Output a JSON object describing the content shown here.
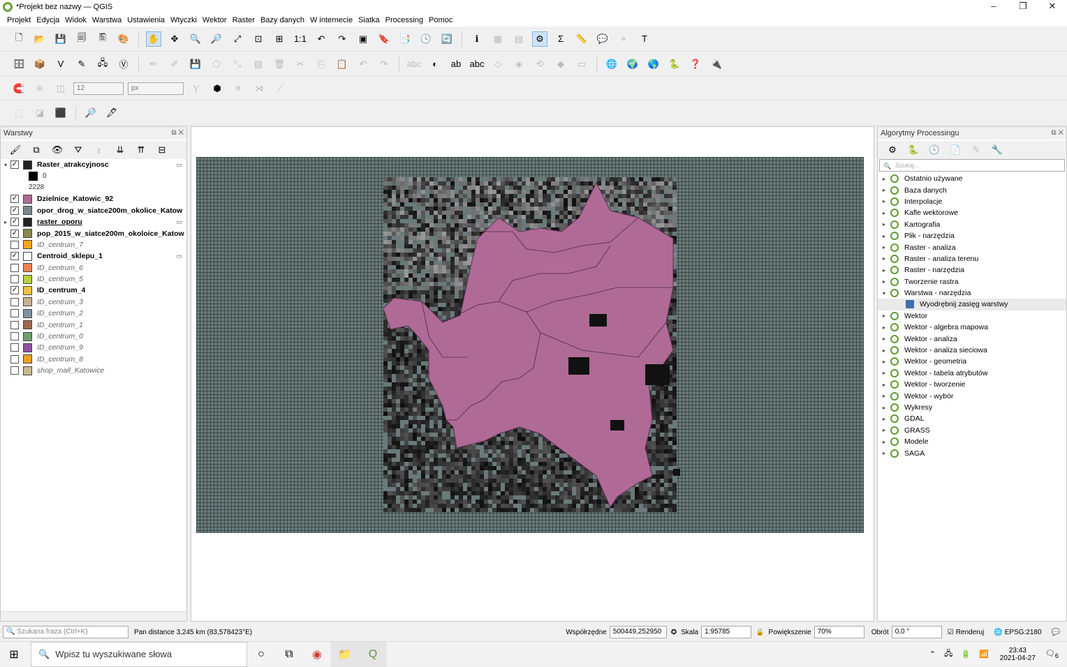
{
  "window": {
    "title": "*Projekt bez nazwy — QGIS",
    "minimize": "–",
    "restore": "❐",
    "close": "✕"
  },
  "menu": [
    "Projekt",
    "Edycja",
    "Widok",
    "Warstwa",
    "Ustawienia",
    "Wtyczki",
    "Wektor",
    "Raster",
    "Bazy danych",
    "W internecie",
    "Siatka",
    "Processing",
    "Pomoc"
  ],
  "snapping": {
    "tolerance": "12",
    "unit": "px"
  },
  "layers_panel": {
    "title": "Warstwy",
    "items": [
      {
        "name": "Raster_atrakcyjnosc",
        "checked": true,
        "style": "bold",
        "color": "#222222",
        "expand": "▾",
        "filter": true
      },
      {
        "legend": "0",
        "color": "#000000"
      },
      {
        "legend": "2228",
        "color": ""
      },
      {
        "name": "Dzielnice_Katowic_92",
        "checked": true,
        "style": "bold",
        "color": "#b06a96"
      },
      {
        "name": "opor_drog_w_siatce200m_okolice_Katow",
        "checked": true,
        "style": "bold",
        "color": "#7a8890"
      },
      {
        "name": "raster_oporu",
        "checked": true,
        "style": "und",
        "color": "#222222",
        "expand": "▸",
        "filter": true
      },
      {
        "name": "pop_2015_w_siatce200m_okoloice_Katow",
        "checked": true,
        "style": "bold",
        "color": "#8a8a4a"
      },
      {
        "name": "ID_centrum_7",
        "checked": false,
        "style": "ital",
        "color": "#f5a623"
      },
      {
        "name": "Centroid_sklepu_1",
        "checked": true,
        "style": "bold",
        "color": "#ffffff",
        "filter": true
      },
      {
        "name": "ID_centrum_6",
        "checked": false,
        "style": "ital",
        "color": "#f08050"
      },
      {
        "name": "ID_centrum_5",
        "checked": false,
        "style": "ital",
        "color": "#b8d040"
      },
      {
        "name": "ID_centrum_4",
        "checked": true,
        "style": "bold",
        "color": "#f0c040"
      },
      {
        "name": "ID_centrum_3",
        "checked": false,
        "style": "ital",
        "color": "#c8b090"
      },
      {
        "name": "ID_centrum_2",
        "checked": false,
        "style": "ital",
        "color": "#8090a0"
      },
      {
        "name": "ID_centrum_1",
        "checked": false,
        "style": "ital",
        "color": "#a06850"
      },
      {
        "name": "ID_centrum_0",
        "checked": false,
        "style": "ital",
        "color": "#70a070"
      },
      {
        "name": "ID_centrum_9",
        "checked": false,
        "style": "ital",
        "color": "#9050a0"
      },
      {
        "name": "ID_centrum_8",
        "checked": false,
        "style": "ital",
        "color": "#f0a020"
      },
      {
        "name": "shop_mall_Katowice",
        "checked": false,
        "style": "ital",
        "color": "#c8b890"
      }
    ]
  },
  "processing_panel": {
    "title": "Algorytmy Processingu",
    "search_placeholder": "Szukaj...",
    "items": [
      {
        "label": "Ostatnio używane",
        "icon": "clock-icon"
      },
      {
        "label": "Baza danych"
      },
      {
        "label": "Interpolacje"
      },
      {
        "label": "Kafle wektorowe"
      },
      {
        "label": "Kartografia"
      },
      {
        "label": "Plik - narzędzia"
      },
      {
        "label": "Raster - analiza"
      },
      {
        "label": "Raster - analiza terenu"
      },
      {
        "label": "Raster - narzędzia"
      },
      {
        "label": "Tworzenie rastra"
      },
      {
        "label": "Warstwa - narzędzia",
        "expanded": true
      },
      {
        "label": "Wyodrębnij zasięg warstwy",
        "sub": true
      },
      {
        "label": "Wektor"
      },
      {
        "label": "Wektor - algebra mapowa"
      },
      {
        "label": "Wektor - analiza"
      },
      {
        "label": "Wektor - analiza sieciowa"
      },
      {
        "label": "Wektor - geometria"
      },
      {
        "label": "Wektor - tabela atrybutów"
      },
      {
        "label": "Wektor - tworzenie"
      },
      {
        "label": "Wektor - wybór"
      },
      {
        "label": "Wykresy"
      },
      {
        "label": "GDAL"
      },
      {
        "label": "GRASS"
      },
      {
        "label": "Modele"
      },
      {
        "label": "SAGA"
      }
    ]
  },
  "status": {
    "search_placeholder": "Szukana fraza (Ctrl+K)",
    "message": "Pan distance 3,245 km (83,578423°E)",
    "coord_label": "Współrzędne",
    "coord_value": "500449,252950",
    "scale_label": "Skala",
    "scale_value": "1:95785",
    "magnifier_label": "Powiększenie",
    "magnifier_value": "70%",
    "rotation_label": "Obrót",
    "rotation_value": "0,0 °",
    "render_label": "Renderuj",
    "crs": "EPSG:2180"
  },
  "taskbar": {
    "search_placeholder": "Wpisz tu wyszukiwane słowa",
    "time": "23:43",
    "date": "2021-04-27",
    "notifications": "6"
  },
  "colors": {
    "district": "#b06a96",
    "grid_bg": "#6a7a7a",
    "grid_line": "#3c4848"
  }
}
